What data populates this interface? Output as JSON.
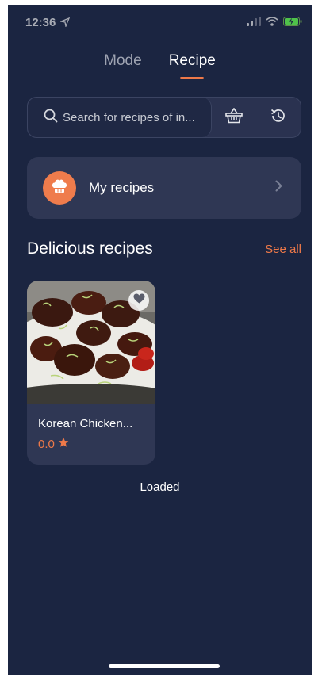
{
  "status_bar": {
    "time": "12:36"
  },
  "tabs": [
    {
      "label": "Mode",
      "active": false
    },
    {
      "label": "Recipe",
      "active": true
    }
  ],
  "search": {
    "placeholder": "Search for recipes of in..."
  },
  "my_recipes": {
    "label": "My recipes"
  },
  "section": {
    "title": "Delicious recipes",
    "see_all": "See all"
  },
  "recipes": [
    {
      "name": "Korean Chicken...",
      "rating": "0.0"
    }
  ],
  "status_message": "Loaded",
  "colors": {
    "background": "#1b2541",
    "accent": "#ee7949",
    "card": "#2f3754"
  }
}
